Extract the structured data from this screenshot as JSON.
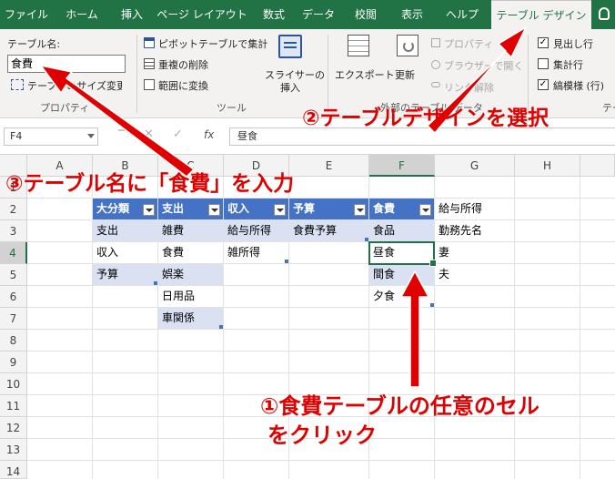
{
  "tabs": {
    "file": "ファイル",
    "home": "ホーム",
    "insert": "挿入",
    "page_layout": "ページ レイアウト",
    "formulas": "数式",
    "data": "データ",
    "review": "校閲",
    "view": "表示",
    "help": "ヘルプ",
    "table_design": "テーブル デザイン"
  },
  "ribbon": {
    "properties": {
      "name_label": "テーブル名:",
      "name_value": "食費",
      "resize_label": "テーブルのサイズ変更",
      "group_label": "プロパティ"
    },
    "tools": {
      "pivot_label": "ピボットテーブルで集計",
      "remove_dup_label": "重複の削除",
      "convert_label": "範囲に変換",
      "slicer_label_1": "スライサーの",
      "slicer_label_2": "挿入",
      "group_label": "ツール"
    },
    "external": {
      "export_label": "エクスポート",
      "refresh_label": "更新",
      "properties_label": "プロパティ",
      "browser_label": "ブラウザーで開く",
      "unlink_label": "リンク解除",
      "group_label": "外部のテーブル データ"
    },
    "style_options": {
      "header_row_label": "見出し行",
      "header_row_checked": true,
      "total_row_label": "集計行",
      "total_row_checked": false,
      "banded_rows_label": "縞模様 (行)",
      "banded_rows_checked": true,
      "group_label": "テーブル スタイルのオプション"
    }
  },
  "formula_bar": {
    "name_box": "F4",
    "fx": "fx",
    "value": "昼食"
  },
  "grid": {
    "columns": [
      "A",
      "B",
      "C",
      "D",
      "E",
      "F",
      "G",
      "H"
    ],
    "rows": [
      "1",
      "2",
      "3",
      "4",
      "5",
      "6",
      "7",
      "8",
      "9",
      "10",
      "11",
      "12",
      "13",
      "14"
    ],
    "selected_column": "F",
    "selected_row": "4"
  },
  "tables": {
    "daibunrui": {
      "header": "大分類",
      "cells": [
        "支出",
        "収入",
        "予算"
      ]
    },
    "shishutsu": {
      "header": "支出",
      "cells": [
        "雑費",
        "食費",
        "娯楽",
        "日用品",
        "車関係"
      ]
    },
    "shunyu": {
      "header": "収入",
      "cells": [
        "給与所得",
        "雑所得"
      ]
    },
    "yosan": {
      "header": "予算",
      "cells": [
        "食費予算"
      ]
    },
    "shokuhi": {
      "header": "食費",
      "cells": [
        "食品",
        "昼食",
        "間食",
        "夕食"
      ]
    }
  },
  "plain_cells": {
    "g2": "給与所得",
    "g3": "勤務先名",
    "g4": "妻",
    "g5": "夫"
  },
  "annotations": {
    "step1_line1": "①食費テーブルの任意のセル",
    "step1_line2": "をクリック",
    "step2": "②テーブルデザインを選択",
    "step3": "③テーブル名に「食費」を入力"
  },
  "colors": {
    "excel_green": "#217346",
    "table_header": "#4472c4",
    "table_band": "#d9e1f2",
    "annotation_red": "#e00000"
  }
}
